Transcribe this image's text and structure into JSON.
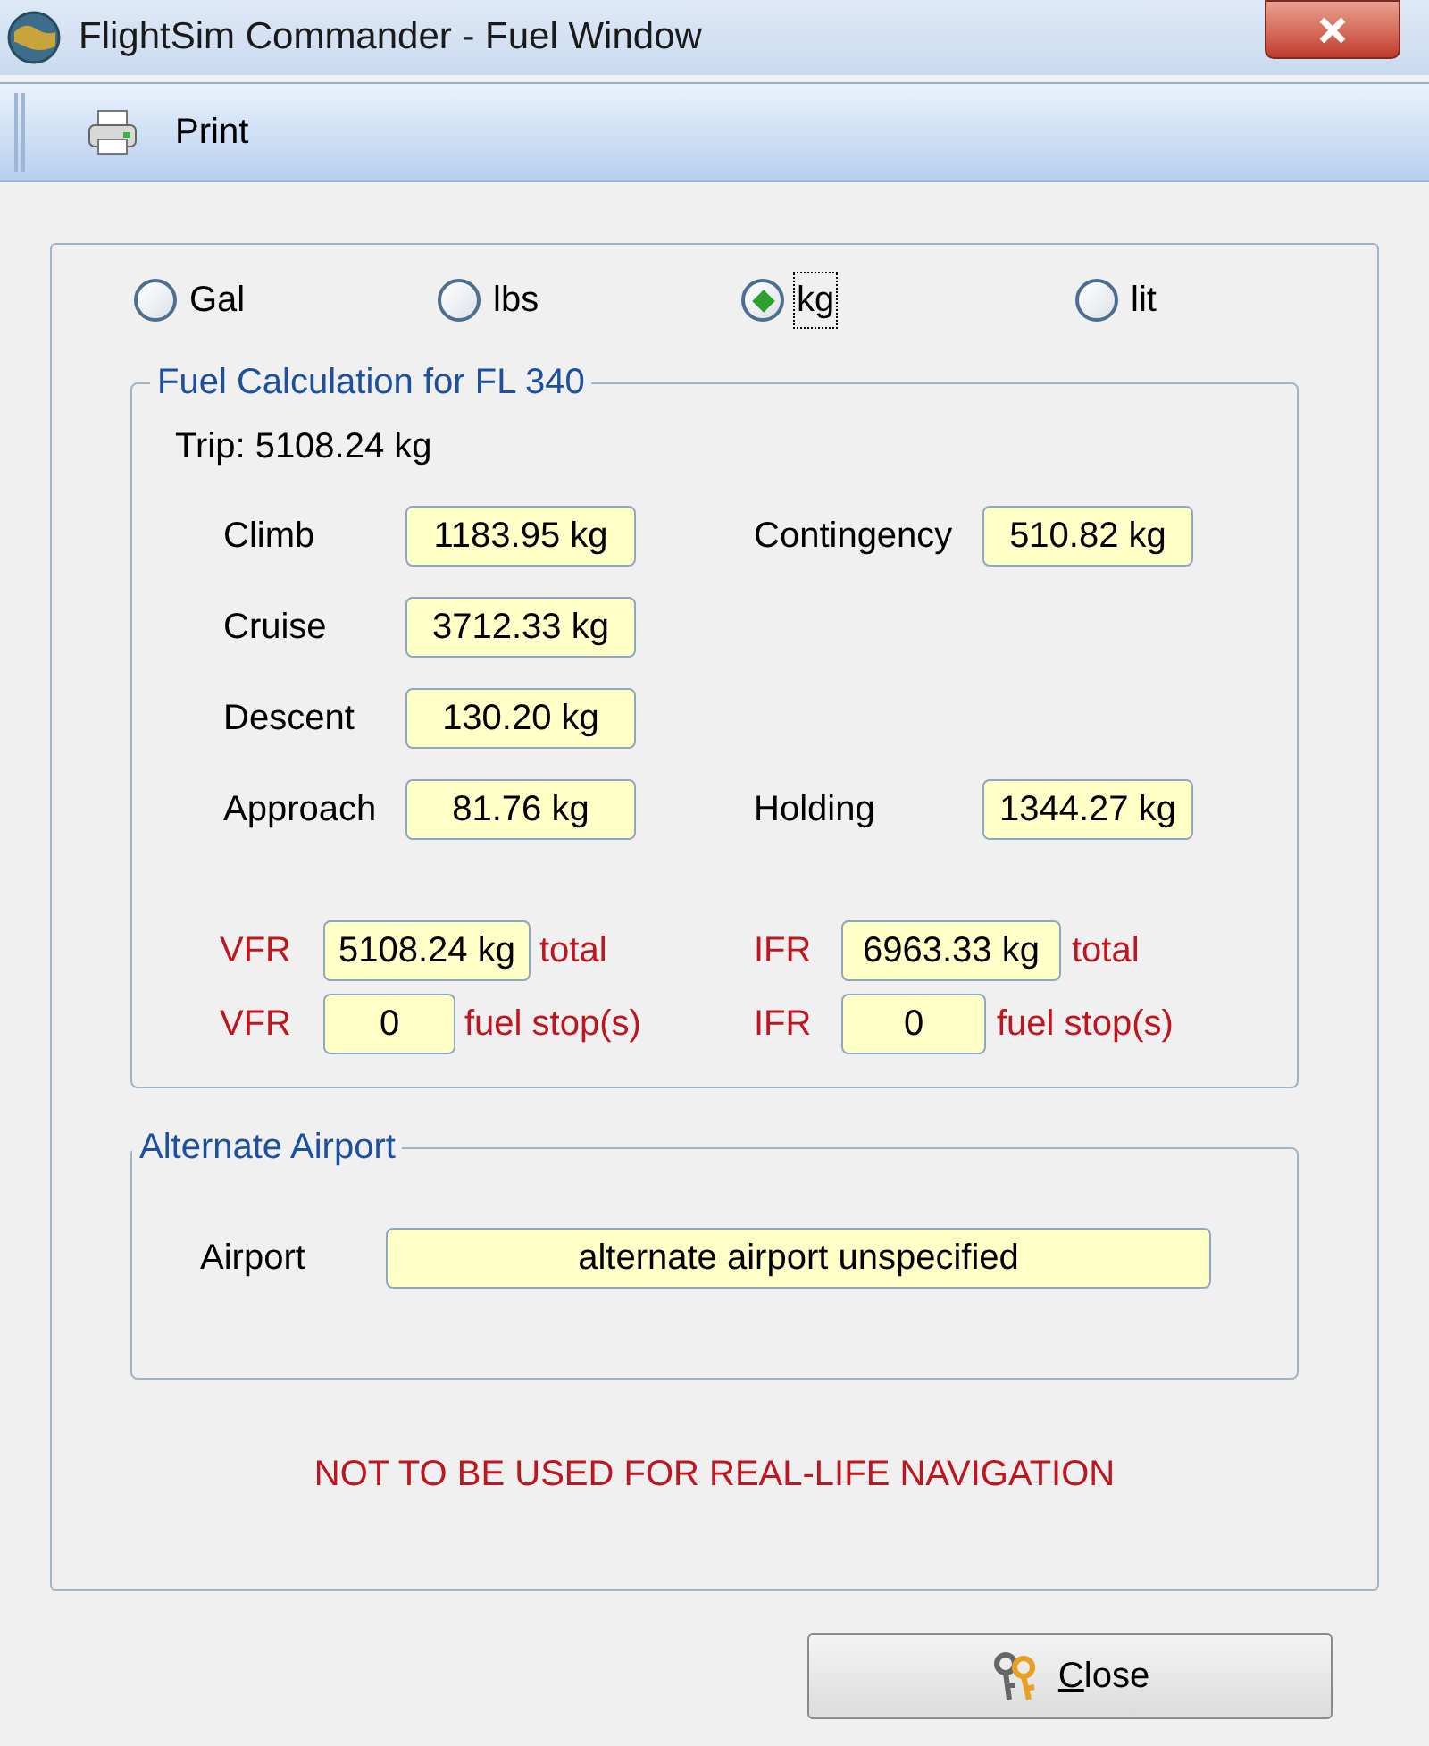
{
  "window": {
    "title": "FlightSim Commander - Fuel Window"
  },
  "toolbar": [
    {
      "label": "Print"
    }
  ],
  "units": [
    {
      "label": "Gal",
      "selected": false,
      "focused": false
    },
    {
      "label": "lbs",
      "selected": false,
      "focused": false
    },
    {
      "label": "kg",
      "selected": true,
      "focused": true
    },
    {
      "label": "lit",
      "selected": false,
      "focused": false
    }
  ],
  "fuel_calculation": {
    "title": "Fuel Calculation for FL 340",
    "trip": "Trip: 5108.24 kg",
    "rows": [
      {
        "left": {
          "label": "Climb",
          "value": "1183.95 kg"
        },
        "right": {
          "label": "Contingency",
          "value": "510.82 kg"
        }
      },
      {
        "left": {
          "label": "Cruise",
          "value": "3712.33 kg"
        }
      },
      {
        "left": {
          "label": "Descent",
          "value": "130.20 kg"
        }
      },
      {
        "left": {
          "label": "Approach",
          "value": "81.76 kg"
        },
        "right": {
          "label": "Holding",
          "value": "1344.27 kg"
        }
      }
    ],
    "totals": [
      {
        "kind": "total",
        "left": {
          "label": "VFR",
          "value": "5108.24 kg",
          "suffix": "total"
        },
        "right": {
          "label": "IFR",
          "value": "6963.33 kg",
          "suffix": "total"
        }
      },
      {
        "kind": "stops",
        "left": {
          "label": "VFR",
          "value": "0",
          "suffix": "fuel stop(s)"
        },
        "right": {
          "label": "IFR",
          "value": "0",
          "suffix": "fuel stop(s)"
        }
      }
    ]
  },
  "alternate": {
    "title": "Alternate Airport",
    "label": "Airport",
    "value": "alternate airport unspecified"
  },
  "warning": "NOT TO BE USED FOR REAL-LIFE NAVIGATION",
  "close_button": {
    "label": "Close",
    "underline_first": true
  }
}
